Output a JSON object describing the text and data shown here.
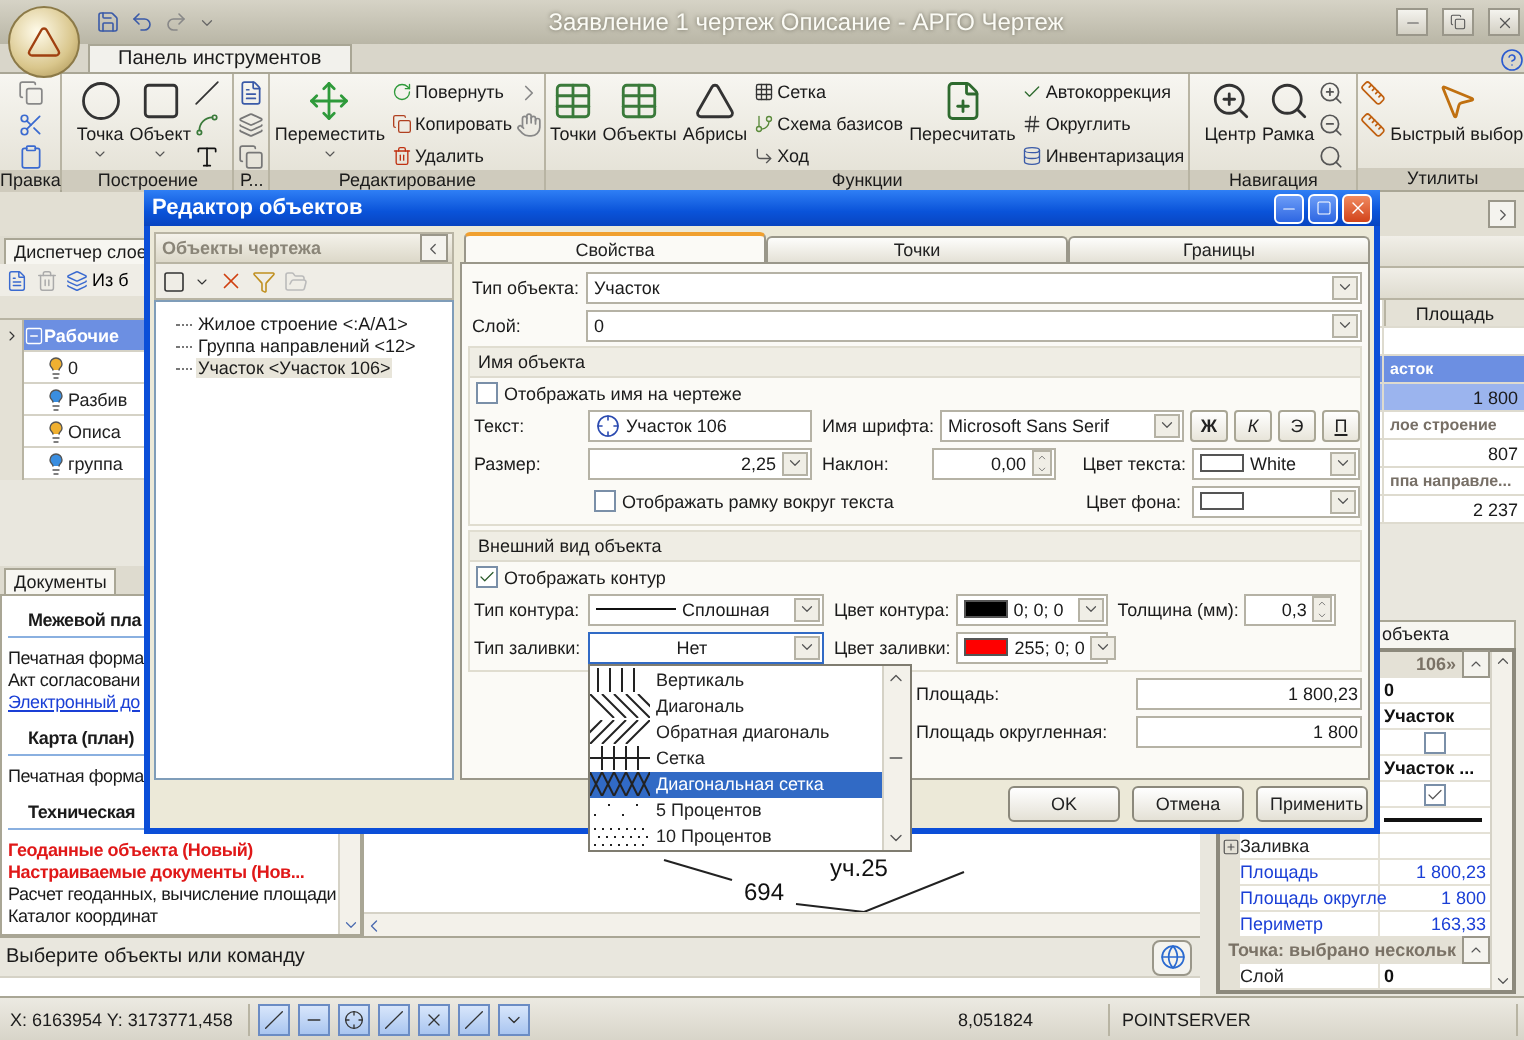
{
  "app": {
    "title": "Заявление 1 чертеж Описание - АРГО Чертеж"
  },
  "ribbon": {
    "tab": "Панель инструментов",
    "groups": [
      {
        "label": "Правка",
        "items": [
          {
            "kind": "icons"
          }
        ]
      },
      {
        "label": "Построение",
        "items": [
          {
            "kind": "large",
            "label": "Точка",
            "menu": true
          },
          {
            "kind": "large",
            "label": "Объект",
            "menu": true
          },
          {
            "kind": "icons"
          }
        ]
      },
      {
        "label": "Р...",
        "items": [
          {
            "kind": "icons"
          }
        ]
      },
      {
        "label": "Редактирование",
        "items": [
          {
            "kind": "large",
            "label": "Переместить",
            "menu": true
          },
          {
            "kind": "stack",
            "entries": [
              "Повернуть",
              "Копировать",
              "Удалить"
            ]
          },
          {
            "kind": "icons"
          }
        ]
      },
      {
        "label": "Функции",
        "items": [
          {
            "kind": "large",
            "label": "Точки",
            "menu": false
          },
          {
            "kind": "large",
            "label": "Объекты",
            "menu": false
          },
          {
            "kind": "large",
            "label": "Абрисы",
            "menu": false
          },
          {
            "kind": "stack",
            "entries": [
              "Сетка",
              "Схема базисов",
              "Ход"
            ]
          },
          {
            "kind": "large",
            "label": "Пересчитать",
            "menu": false
          },
          {
            "kind": "stack",
            "entries": [
              "Автокоррекция",
              "Округлить",
              "Инвентаризация"
            ]
          }
        ]
      },
      {
        "label": "Навигация",
        "items": [
          {
            "kind": "large",
            "label": "Центр",
            "menu": false
          },
          {
            "kind": "large",
            "label": "Рамка",
            "menu": false
          },
          {
            "kind": "icons"
          }
        ]
      },
      {
        "label": "Утилиты",
        "items": [
          {
            "kind": "icons"
          },
          {
            "kind": "large",
            "label": "Быстрый выбор",
            "menu": false
          }
        ]
      }
    ]
  },
  "layers_panel": {
    "tab": "Диспетчер слое",
    "toolbar_label": "Из б",
    "rows": [
      {
        "kind": "group",
        "text": "Рабочие",
        "selected": true
      },
      {
        "kind": "layer",
        "text": "0",
        "color": "#f0b030"
      },
      {
        "kind": "layer",
        "text": "Разбив",
        "color": "#3a8ee0"
      },
      {
        "kind": "layer",
        "text": "Описа",
        "color": "#f0b030"
      },
      {
        "kind": "layer",
        "text": "группа",
        "color": "#3a8ee0"
      }
    ]
  },
  "documents_panel": {
    "tab": "Документы",
    "items": [
      {
        "kind": "heading",
        "text": "Межевой пла"
      },
      {
        "kind": "item",
        "text": "Печатная форма"
      },
      {
        "kind": "item",
        "text": "Акт согласовани"
      },
      {
        "kind": "link",
        "text": "Электронный до"
      },
      {
        "kind": "heading",
        "text": "Карта (план)"
      },
      {
        "kind": "item",
        "text": "Печатная форма"
      },
      {
        "kind": "heading",
        "text": "Техническая"
      },
      {
        "kind": "new",
        "text": "Геоданные объекта (Новый)"
      },
      {
        "kind": "new",
        "text": "Настраиваемые документы (Нов..."
      },
      {
        "kind": "item",
        "text": "Расчет геоданных, вычисление площади"
      },
      {
        "kind": "item",
        "text": "Каталог координат"
      }
    ]
  },
  "canvas": {
    "labels": [
      "уч.25",
      "694"
    ]
  },
  "objects_table": {
    "columns": [
      "Площадь"
    ],
    "rows": [
      {
        "kind": "group",
        "text": "асток",
        "selected": true
      },
      {
        "kind": "value",
        "value": "1 800",
        "selected": true
      },
      {
        "kind": "group",
        "text": "лое строение",
        "selected": false
      },
      {
        "kind": "value",
        "value": "807",
        "selected": false
      },
      {
        "kind": "group",
        "text": "ппа направле...",
        "selected": false
      },
      {
        "kind": "value",
        "value": "2 237",
        "selected": false
      }
    ]
  },
  "properties_panel": {
    "tab": "объекта",
    "rows": [
      {
        "kind": "header",
        "text": "106»"
      },
      {
        "kind": "value",
        "value": "0"
      },
      {
        "kind": "value",
        "value": "Участок"
      },
      {
        "kind": "check",
        "checked": false
      },
      {
        "kind": "value",
        "value": "Участок ..."
      },
      {
        "kind": "check",
        "checked": true
      },
      {
        "kind": "line"
      },
      {
        "kind": "group",
        "name": "Заливка"
      },
      {
        "kind": "link",
        "name": "Площадь",
        "value": "1 800,23"
      },
      {
        "kind": "link",
        "name": "Площадь округле",
        "value": "1 800"
      },
      {
        "kind": "link",
        "name": "Периметр",
        "value": "163,33"
      },
      {
        "kind": "header",
        "text": "Точка: выбрано нескольк"
      },
      {
        "kind": "plain",
        "name": "Слой",
        "value": "0"
      }
    ]
  },
  "status": "Выберите объекты или команду",
  "status_bar": {
    "coordinates": "X: 6163954 Y: 3173771,458",
    "scale": "8,051824",
    "server": "POINTSERVER"
  },
  "dialog": {
    "title": "Редактор объектов",
    "objects_pane": {
      "title": "Объекты чертежа",
      "tree": [
        {
          "label": "Жилое строение <:А/А1>",
          "selected": false
        },
        {
          "label": "Группа направлений <12>",
          "selected": false
        },
        {
          "label": "Участок <Участок 106>",
          "selected": true
        }
      ]
    },
    "tabs": [
      {
        "label": "Свойства",
        "selected": true
      },
      {
        "label": "Точки",
        "selected": false
      },
      {
        "label": "Границы",
        "selected": false
      }
    ],
    "object_type": {
      "label": "Тип объекта:",
      "value": "Участок"
    },
    "layer": {
      "label": "Слой:",
      "value": "0"
    },
    "name_section": {
      "title": "Имя объекта",
      "show_name": {
        "label": "Отображать имя на чертеже",
        "checked": false
      },
      "text": {
        "label": "Текст:",
        "value": "Участок 106"
      },
      "font": {
        "label": "Имя шрифта:",
        "value": "Microsoft Sans Serif"
      },
      "style_buttons": [
        {
          "label": "Ж",
          "kind": "bold"
        },
        {
          "label": "К",
          "kind": "italic"
        },
        {
          "label": "Э",
          "kind": "plain"
        },
        {
          "label": "П",
          "kind": "underline"
        }
      ],
      "size": {
        "label": "Размер:",
        "value": "2,25"
      },
      "slant": {
        "label": "Наклон:",
        "value": "0,00"
      },
      "text_color": {
        "label": "Цвет текста:",
        "value": "White",
        "color": "#ffffff"
      },
      "show_frame": {
        "label": "Отображать рамку вокруг текста",
        "checked": false
      },
      "background_color": {
        "label": "Цвет фона:",
        "color": "#ffffff"
      }
    },
    "look_section": {
      "title": "Внешний вид объекта",
      "show_contour": {
        "label": "Отображать контур",
        "checked": true
      },
      "contour_type": {
        "label": "Тип контура:",
        "value": "Сплошная"
      },
      "contour_color": {
        "label": "Цвет контура:",
        "value": "0; 0; 0",
        "color": "#000000"
      },
      "thickness": {
        "label": "Толщина (мм):",
        "value": "0,3"
      },
      "fill_type": {
        "label": "Тип заливки:",
        "value": "Нет",
        "expanded": true
      },
      "fill_color": {
        "label": "Цвет заливки:",
        "value": "255; 0; 0",
        "color": "#ff0000"
      },
      "fill_options": [
        {
          "label": "Вертикаль",
          "kind": "vertical",
          "selected": false
        },
        {
          "label": "Диагональ",
          "kind": "diagonal",
          "selected": false
        },
        {
          "label": "Обратная диагональ",
          "kind": "backdiagonal",
          "selected": false
        },
        {
          "label": "Сетка",
          "kind": "grid",
          "selected": false
        },
        {
          "label": "Диагональная сетка",
          "kind": "diagcross",
          "selected": true
        },
        {
          "label": "5 Процентов",
          "kind": "percent5",
          "selected": false
        },
        {
          "label": "10 Процентов",
          "kind": "percent10",
          "selected": false
        }
      ]
    },
    "area": {
      "label": "Площадь:",
      "value": "1 800,23"
    },
    "area_rounded": {
      "label": "Площадь округленная:",
      "value": "1 800"
    },
    "buttons": [
      "OK",
      "Отмена",
      "Применить"
    ]
  }
}
